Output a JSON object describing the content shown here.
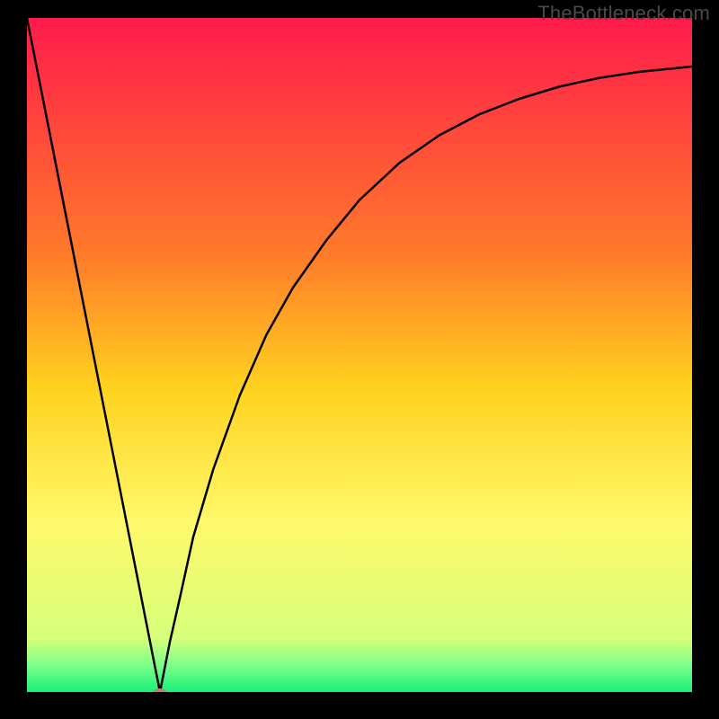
{
  "watermark": "TheBottleneck.com",
  "chart_data": {
    "type": "line",
    "title": "",
    "xlabel": "",
    "ylabel": "",
    "xlim": [
      0,
      100
    ],
    "ylim": [
      0,
      100
    ],
    "grid": false,
    "legend": false,
    "gradient_stops": [
      {
        "offset": 0,
        "color": "#ff1a4b"
      },
      {
        "offset": 35,
        "color": "#ff7a2a"
      },
      {
        "offset": 55,
        "color": "#ffd21f"
      },
      {
        "offset": 75,
        "color": "#fff96b"
      },
      {
        "offset": 92,
        "color": "#d6ff7a"
      },
      {
        "offset": 96,
        "color": "#7dff8a"
      },
      {
        "offset": 100,
        "color": "#18f07a"
      }
    ],
    "marker": {
      "x": 20,
      "y": 0,
      "color": "#c77a6f",
      "rx": 7,
      "ry": 4
    },
    "series": [
      {
        "name": "bottleneck-curve",
        "x": [
          0,
          5,
          10,
          13,
          16,
          18.5,
          19.5,
          20,
          20.5,
          21.5,
          23,
          25,
          28,
          32,
          36,
          40,
          45,
          50,
          56,
          62,
          68,
          74,
          80,
          86,
          92,
          98,
          100
        ],
        "y": [
          100,
          75,
          50,
          35,
          20,
          7.5,
          2.5,
          0,
          2.5,
          7.5,
          14,
          23,
          33,
          44,
          53,
          60,
          67,
          73,
          78.5,
          82.6,
          85.7,
          88,
          89.8,
          91.1,
          92,
          92.6,
          92.8
        ]
      }
    ]
  }
}
